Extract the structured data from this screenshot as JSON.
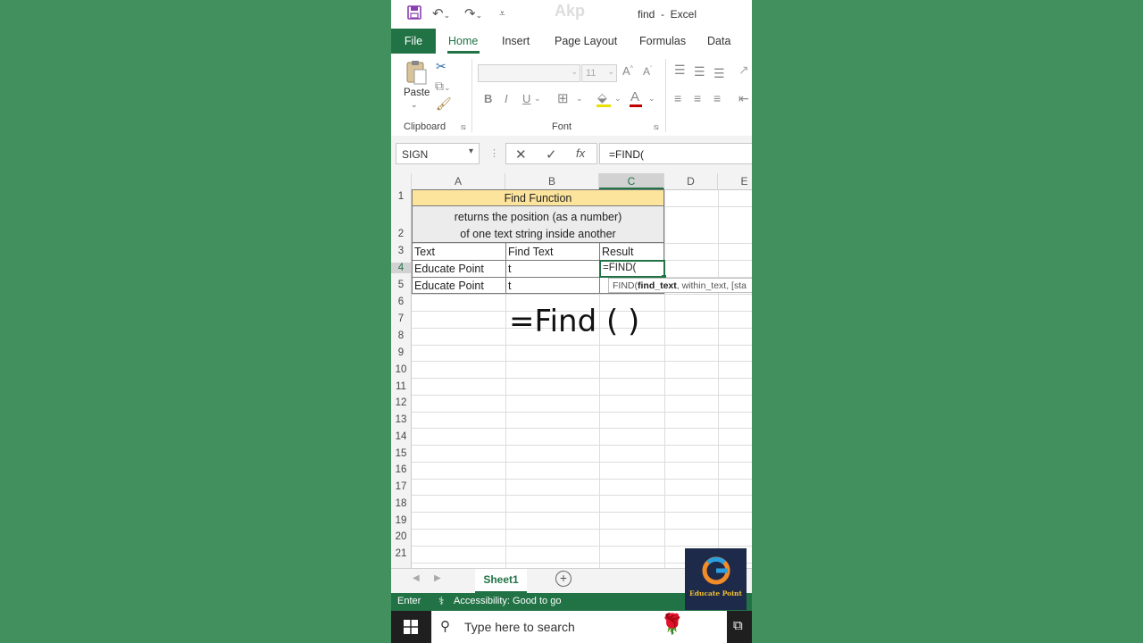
{
  "window": {
    "title": "find  -  Excel",
    "watermark": "Akp"
  },
  "ribbon": {
    "tabs": [
      "File",
      "Home",
      "Insert",
      "Page Layout",
      "Formulas",
      "Data"
    ],
    "active_tab": "Home",
    "clipboard": {
      "paste_label": "Paste",
      "group_label": "Clipboard"
    },
    "font": {
      "font_size": "11",
      "bold": "B",
      "italic": "I",
      "underline": "U",
      "group_label": "Font"
    }
  },
  "formula_bar": {
    "name_box": "SIGN",
    "fx_label": "fx",
    "formula": "=FIND("
  },
  "columns": [
    "A",
    "B",
    "C",
    "D",
    "E"
  ],
  "rows": [
    "1",
    "2",
    "3",
    "4",
    "5",
    "6",
    "7",
    "8",
    "9",
    "10",
    "11",
    "12",
    "13",
    "14",
    "15",
    "16",
    "17",
    "18",
    "19",
    "20",
    "21"
  ],
  "cells": {
    "title": "Find Function",
    "desc_line1": "returns the position (as a number)",
    "desc_line2": "of one text string inside another",
    "a3": "Text",
    "b3": "Find Text",
    "c3": "Result",
    "a4": "Educate Point",
    "b4": "t",
    "c4": "=FIND(",
    "a5": "Educate Point",
    "b5": "t"
  },
  "tooltip": {
    "fn": "FIND(",
    "arg1": "find_text",
    "rest": ", within_text, [sta"
  },
  "overlay_caption": "=Find ( )",
  "sheets": {
    "active": "Sheet1"
  },
  "status": {
    "mode": "Enter",
    "accessibility": "Accessibility: Good to go"
  },
  "taskbar": {
    "search_placeholder": "Type here to search"
  },
  "logo": {
    "text": "Educate Point"
  },
  "colors": {
    "excel_green": "#217346",
    "header_fill": "#fce49c",
    "background": "#43905f"
  }
}
